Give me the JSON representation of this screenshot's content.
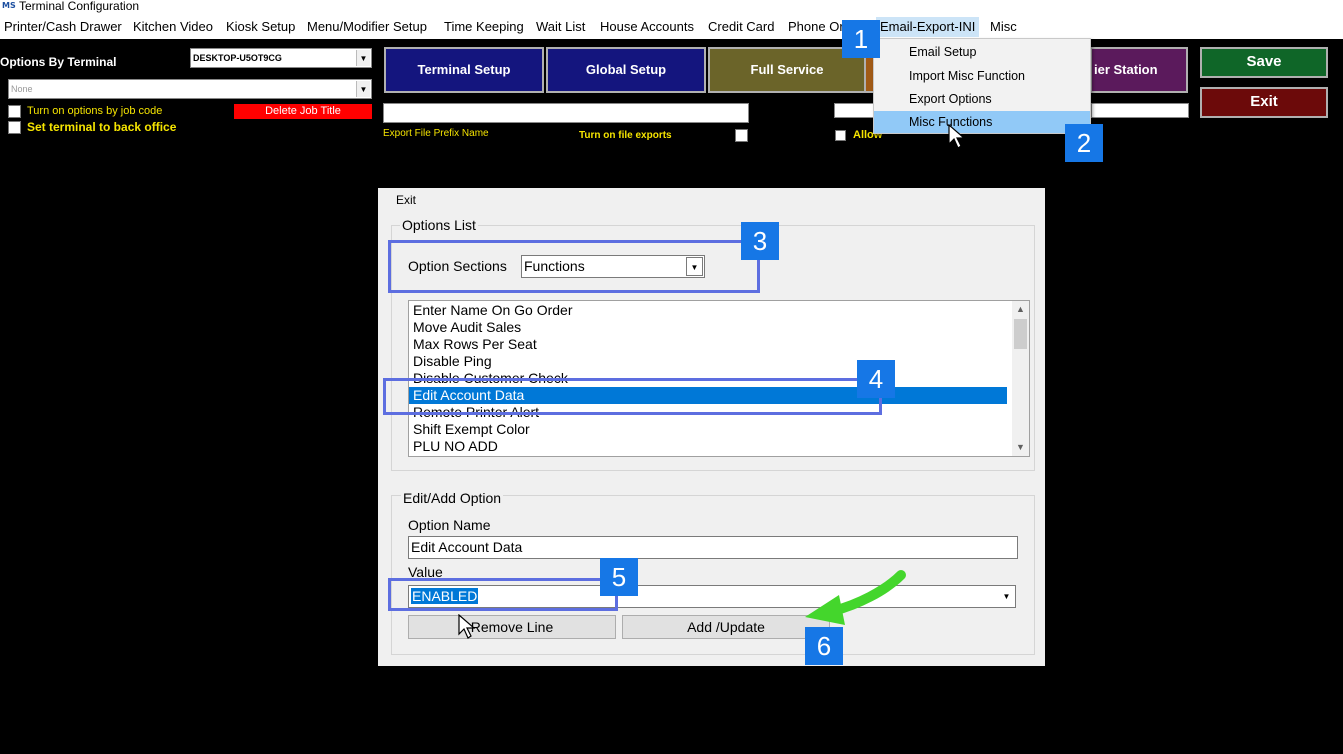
{
  "window": {
    "title": "Terminal Configuration",
    "logo": "MS"
  },
  "menu": [
    "Printer/Cash Drawer",
    "Kitchen Video",
    "Kiosk Setup",
    "Menu/Modifier Setup",
    "Time Keeping",
    "Wait List",
    "House Accounts",
    "Credit Card",
    "Phone Or",
    "Email-Export-INI",
    "Misc"
  ],
  "dropdown": [
    "Email Setup",
    "Import Misc Function",
    "Export Options",
    "Misc Functions"
  ],
  "left_panel": {
    "title": "Options By Terminal",
    "terminal_select": "DESKTOP-U5OT9CG",
    "job_select": "None",
    "job_code_label": "Turn on options by job code",
    "delete_job_title": "Delete Job Title",
    "back_office_label": "Set terminal to back office"
  },
  "top_buttons": {
    "terminal_setup": "Terminal Setup",
    "global_setup": "Global Setup",
    "full_service": "Full Service",
    "station": "ier Station",
    "save": "Save",
    "exit": "Exit"
  },
  "export_row": {
    "prefix_label": "Export File Prefix Name",
    "file_exports_label": "Turn on file exports",
    "allow_label": "Allow"
  },
  "dialog": {
    "menu_exit": "Exit",
    "options_list_label": "Options List",
    "option_sections_label": "Option Sections",
    "option_sections_value": "Functions",
    "list_items": [
      "Enter Name On Go Order",
      "Move Audit Sales",
      "Max Rows Per Seat",
      "Disable Ping",
      "Disable Customer Check",
      "Edit Account Data",
      "Remote Printer Alert",
      "Shift Exempt Color",
      "PLU NO ADD"
    ],
    "edit_add_label": "Edit/Add Option",
    "option_name_label": "Option Name",
    "option_name_value": "Edit Account Data",
    "value_label": "Value",
    "value_value": "ENABLED",
    "remove_line": "Remove Line",
    "add_update": "Add /Update"
  },
  "callouts": [
    "1",
    "2",
    "3",
    "4",
    "5",
    "6"
  ],
  "colors": {
    "callout_blue": "#1677e6",
    "highlight_box": "#5d6ee0",
    "arrow_green": "#44d62c",
    "selection_blue": "#0078d7",
    "label_yellow": "#f5e400"
  },
  "icons": {
    "cursor": "mouse-pointer-icon",
    "arrow": "green-arrow-icon"
  }
}
